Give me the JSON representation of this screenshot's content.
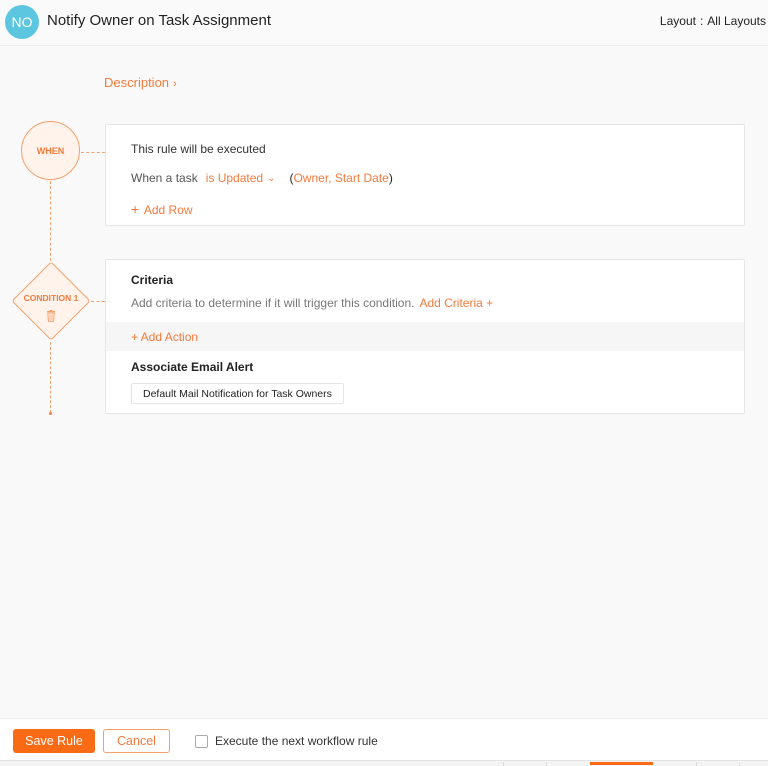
{
  "header": {
    "avatar_initials": "NO",
    "title": "Notify Owner on Task Assignment",
    "layout_label": "Layout",
    "layout_separator": ":",
    "layout_value": "All Layouts"
  },
  "description": {
    "label": "Description",
    "chevron": "›"
  },
  "flow": {
    "when_node_label": "WHEN",
    "condition_node_label": "CONDITION 1"
  },
  "when_card": {
    "title": "This rule will be executed",
    "prefix": "When a task",
    "trigger": "is Updated",
    "trigger_caret": "⌄",
    "fields_open": "(",
    "fields": "Owner, Start Date",
    "fields_close": ")",
    "add_row_plus": "+",
    "add_row_label": "Add Row"
  },
  "condition_card": {
    "criteria_title": "Criteria",
    "criteria_text": "Add criteria to determine if it will trigger this condition.",
    "add_criteria_label": "Add Criteria +",
    "add_action_label": "+ Add Action",
    "email_alert_title": "Associate Email Alert",
    "email_alert_value": "Default Mail Notification for Task Owners"
  },
  "footer": {
    "save_label": "Save Rule",
    "cancel_label": "Cancel",
    "execute_next_label": "Execute the next workflow rule",
    "execute_next_checked": false
  },
  "colors": {
    "accent": "#fb6a14",
    "accent_text": "#f47a3c",
    "avatar_bg": "#5cc6e0"
  }
}
